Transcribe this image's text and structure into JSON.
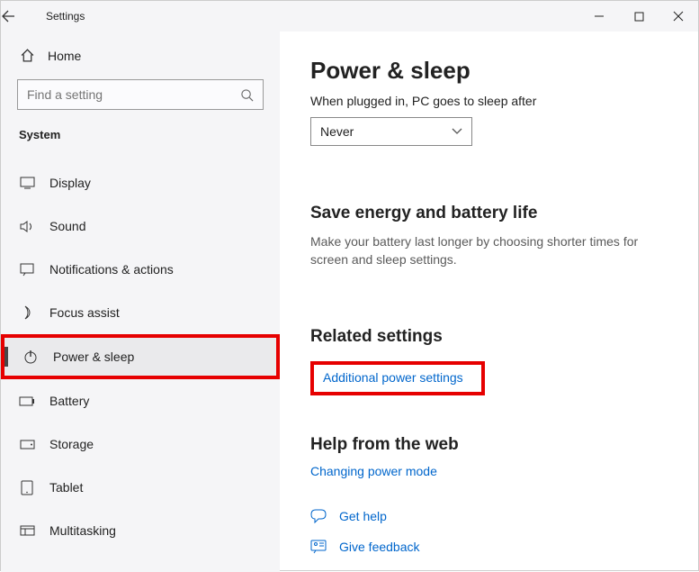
{
  "app_title": "Settings",
  "sidebar": {
    "home_label": "Home",
    "search_placeholder": "Find a setting",
    "section_title": "System",
    "items": [
      {
        "label": "Display"
      },
      {
        "label": "Sound"
      },
      {
        "label": "Notifications & actions"
      },
      {
        "label": "Focus assist"
      },
      {
        "label": "Power & sleep"
      },
      {
        "label": "Battery"
      },
      {
        "label": "Storage"
      },
      {
        "label": "Tablet"
      },
      {
        "label": "Multitasking"
      }
    ]
  },
  "content": {
    "title": "Power & sleep",
    "sleep_label": "When plugged in, PC goes to sleep after",
    "sleep_value": "Never",
    "energy_heading": "Save energy and battery life",
    "energy_text": "Make your battery last longer by choosing shorter times for screen and sleep settings.",
    "related_heading": "Related settings",
    "related_link": "Additional power settings",
    "help_heading": "Help from the web",
    "help_link": "Changing power mode",
    "get_help": "Get help",
    "give_feedback": "Give feedback"
  }
}
